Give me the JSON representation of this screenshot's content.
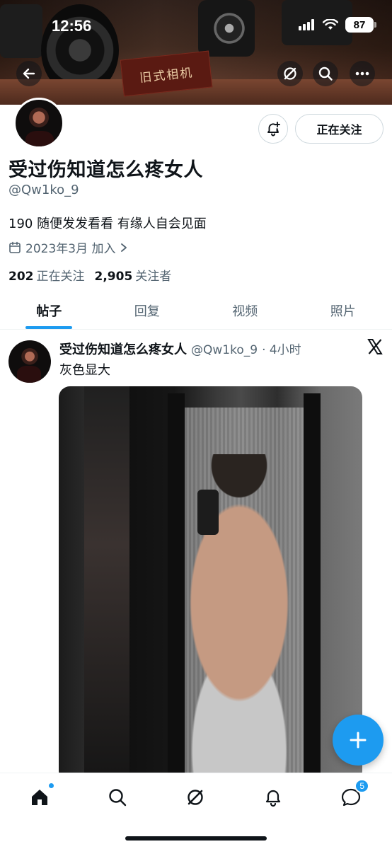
{
  "status_bar": {
    "time": "12:56",
    "battery": "87"
  },
  "banner": {
    "sign_text": "旧式相机"
  },
  "header": {
    "back_icon": "arrow-left-icon",
    "grok_icon": "grok-icon",
    "search_icon": "search-icon",
    "more_icon": "more-icon"
  },
  "profile": {
    "display_name": "受过伤知道怎么疼女人",
    "handle": "@Qw1ko_9",
    "bio": "190 随便发发看看 有缘人自会见面",
    "joined": "2023年3月 加入",
    "following_count": "202",
    "following_label": "正在关注",
    "followers_count": "2,905",
    "followers_label": "关注者",
    "follow_button": "正在关注",
    "notify_icon": "bell-plus-icon"
  },
  "tabs": [
    {
      "label": "帖子",
      "active": true
    },
    {
      "label": "回复",
      "active": false
    },
    {
      "label": "视频",
      "active": false
    },
    {
      "label": "照片",
      "active": false
    }
  ],
  "post": {
    "author": "受过伤知道怎么疼女人",
    "handle": "@Qw1ko_9",
    "time": "· 4小时",
    "text": "灰色显大",
    "source_icon": "x-logo-icon",
    "media_desc": "mirror-selfie-photo"
  },
  "fab": {
    "icon": "plus-icon"
  },
  "bottom_nav": {
    "items": [
      {
        "name": "home",
        "icon": "home-icon"
      },
      {
        "name": "search",
        "icon": "search-icon"
      },
      {
        "name": "grok",
        "icon": "grok-icon"
      },
      {
        "name": "notifications",
        "icon": "bell-icon"
      },
      {
        "name": "messages",
        "icon": "messages-icon",
        "badge": "5"
      }
    ]
  },
  "colors": {
    "accent": "#1d9bf0",
    "text": "#0f1419",
    "muted": "#536471"
  }
}
